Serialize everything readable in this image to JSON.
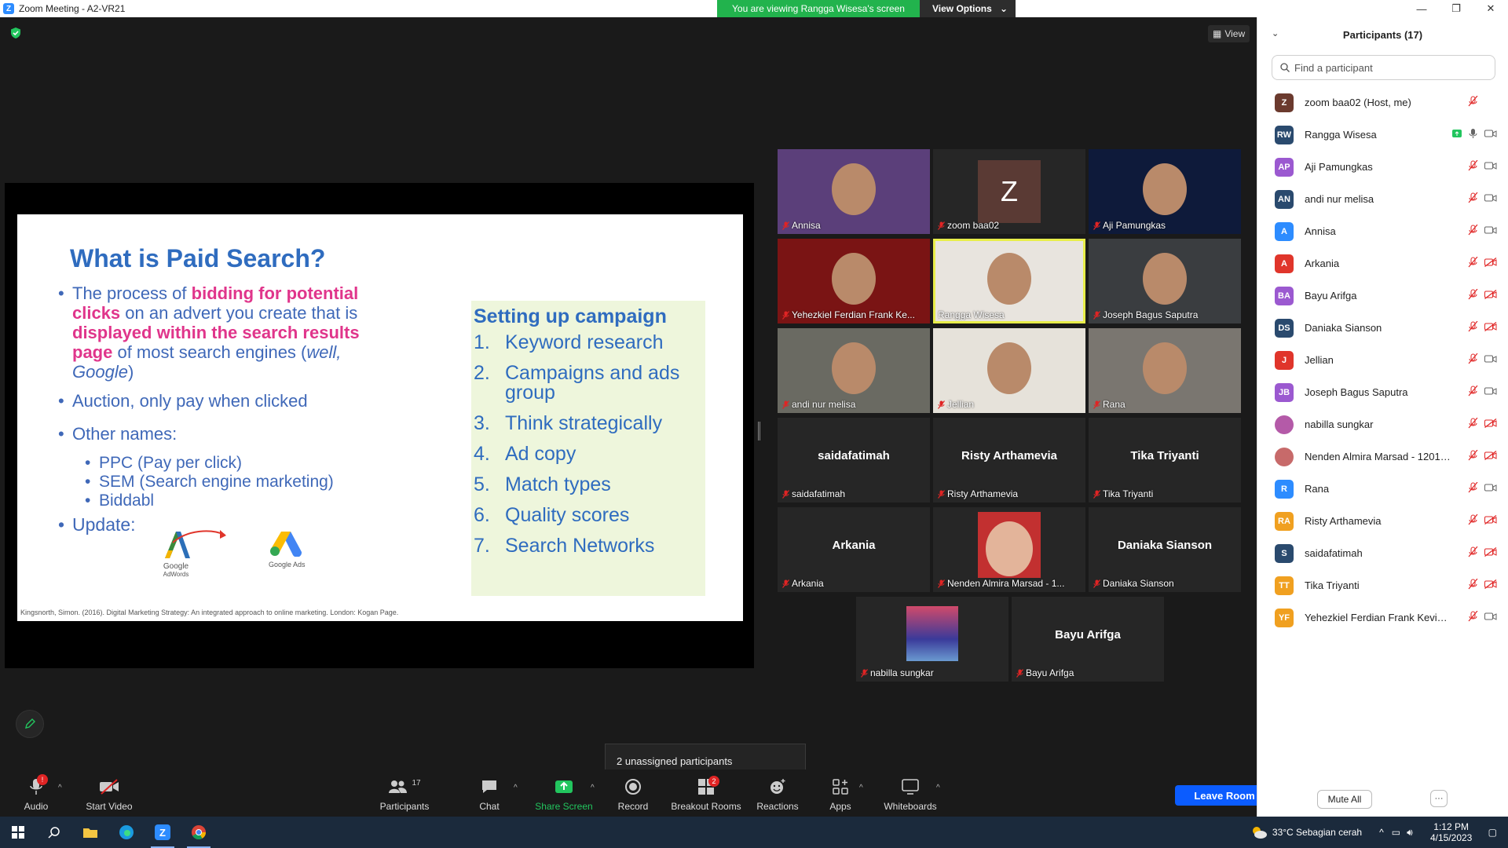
{
  "window": {
    "title": "Zoom Meeting - A2-VR21",
    "minimize": "—",
    "restore": "❐",
    "close": "✕"
  },
  "banner": {
    "message": "You are viewing Rangga Wisesa's screen",
    "options": "View Options"
  },
  "view_button": "View",
  "slide": {
    "title": "What is Paid Search?",
    "b1_pre": "The process of ",
    "b1_hl1": "bidding for potential clicks",
    "b1_mid": " on an advert you create that is ",
    "b1_hl2": "displayed within the search results page",
    "b1_post": " of most search engines (",
    "b1_it1": "well, Google",
    "b1_end": ")",
    "b2": "Auction, only pay when clicked",
    "b3": "Other names:",
    "subs": [
      "PPC (Pay per click)",
      "SEM (Search engine marketing)",
      "Biddabl"
    ],
    "b4": "Update:",
    "logo1_label": "Google",
    "logo1_sub": "AdWords",
    "logo2_label": "Google Ads",
    "box_title": "Setting up campaign",
    "steps": [
      {
        "n": "1.",
        "t": "Keyword research"
      },
      {
        "n": "2.",
        "t": "Campaigns and ads group"
      },
      {
        "n": "3.",
        "t": "Think strategically"
      },
      {
        "n": "4.",
        "t": "Ad copy"
      },
      {
        "n": "5.",
        "t": "Match types"
      },
      {
        "n": "6.",
        "t": "Quality scores"
      },
      {
        "n": "7.",
        "t": "Search Networks"
      }
    ],
    "footnote": "Kingsnorth, Simon. (2016). Digital Marketing Strategy: An integrated approach to online marketing. London: Kogan Page."
  },
  "gallery": [
    {
      "name": "Annisa",
      "big": ""
    },
    {
      "name": "zoom baa02",
      "big": "Z"
    },
    {
      "name": "Aji Pamungkas",
      "big": ""
    },
    {
      "name": "Yehezkiel Ferdian Frank Ke...",
      "big": ""
    },
    {
      "name": "Rangga Wisesa",
      "big": ""
    },
    {
      "name": "Joseph Bagus Saputra",
      "big": ""
    },
    {
      "name": "andi nur melisa",
      "big": ""
    },
    {
      "name": "Jellian",
      "big": ""
    },
    {
      "name": "Rana",
      "big": ""
    },
    {
      "name": "saidafatimah",
      "big": "saidafatimah"
    },
    {
      "name": "Risty Arthamevia",
      "big": "Risty Arthamevia"
    },
    {
      "name": "Tika Triyanti",
      "big": "Tika Triyanti"
    },
    {
      "name": "Arkania",
      "big": "Arkania"
    },
    {
      "name": "Nenden Almira Marsad - 1...",
      "big": ""
    },
    {
      "name": "Daniaka Sianson",
      "big": "Daniaka Sianson"
    },
    {
      "name": "nabilla sungkar",
      "big": ""
    },
    {
      "name": "Bayu Arifga",
      "big": "Bayu Arifga"
    }
  ],
  "unassigned": "2 unassigned participants",
  "toolbar": {
    "audio": "Audio",
    "audio_badge": "!",
    "video": "Start Video",
    "participants": "Participants",
    "participants_count": "17",
    "chat": "Chat",
    "share": "Share Screen",
    "record": "Record",
    "breakout": "Breakout Rooms",
    "breakout_badge": "2",
    "reactions": "Reactions",
    "apps": "Apps",
    "whiteboards": "Whiteboards",
    "leave": "Leave Room"
  },
  "panel": {
    "title": "Participants (17)",
    "search_placeholder": "Find a participant",
    "mute_all": "Mute All",
    "more": "···",
    "participants": [
      {
        "initials": "Z",
        "name": "zoom baa02 (Host, me)",
        "color": "#6b3a2e",
        "video": "none"
      },
      {
        "initials": "RW",
        "name": "Rangga Wisesa",
        "color": "#2a4a6e",
        "video": "on",
        "sharing": true,
        "mic": "on"
      },
      {
        "initials": "AP",
        "name": "Aji Pamungkas",
        "color": "#9b59d0",
        "video": "on"
      },
      {
        "initials": "AN",
        "name": "andi nur melisa",
        "color": "#2a4a6e",
        "video": "on"
      },
      {
        "initials": "A",
        "name": "Annisa",
        "color": "#2d8cff",
        "video": "on"
      },
      {
        "initials": "A",
        "name": "Arkania",
        "color": "#e0352b",
        "video": "off"
      },
      {
        "initials": "BA",
        "name": "Bayu Arifga",
        "color": "#9b59d0",
        "video": "off"
      },
      {
        "initials": "DS",
        "name": "Daniaka Sianson",
        "color": "#2a4a6e",
        "video": "off"
      },
      {
        "initials": "J",
        "name": "Jellian",
        "color": "#e0352b",
        "video": "on"
      },
      {
        "initials": "JB",
        "name": "Joseph Bagus Saputra",
        "color": "#9b59d0",
        "video": "on"
      },
      {
        "initials": "",
        "name": "nabilla sungkar",
        "color": "#b45aa8",
        "video": "off"
      },
      {
        "initials": "",
        "name": "Nenden Almira Marsad - 12017...",
        "color": "#c76a6a",
        "video": "off"
      },
      {
        "initials": "R",
        "name": "Rana",
        "color": "#2d8cff",
        "video": "on"
      },
      {
        "initials": "RA",
        "name": "Risty Arthamevia",
        "color": "#f0a020",
        "video": "off"
      },
      {
        "initials": "S",
        "name": "saidafatimah",
        "color": "#2a4a6e",
        "video": "off"
      },
      {
        "initials": "TT",
        "name": "Tika Triyanti",
        "color": "#f0a020",
        "video": "off"
      },
      {
        "initials": "YF",
        "name": "Yehezkiel Ferdian Frank Kevin Ru...",
        "color": "#f0a020",
        "video": "on"
      }
    ]
  },
  "taskbar": {
    "weather": "33°C  Sebagian cerah",
    "time": "1:12 PM",
    "date": "4/15/2023"
  }
}
